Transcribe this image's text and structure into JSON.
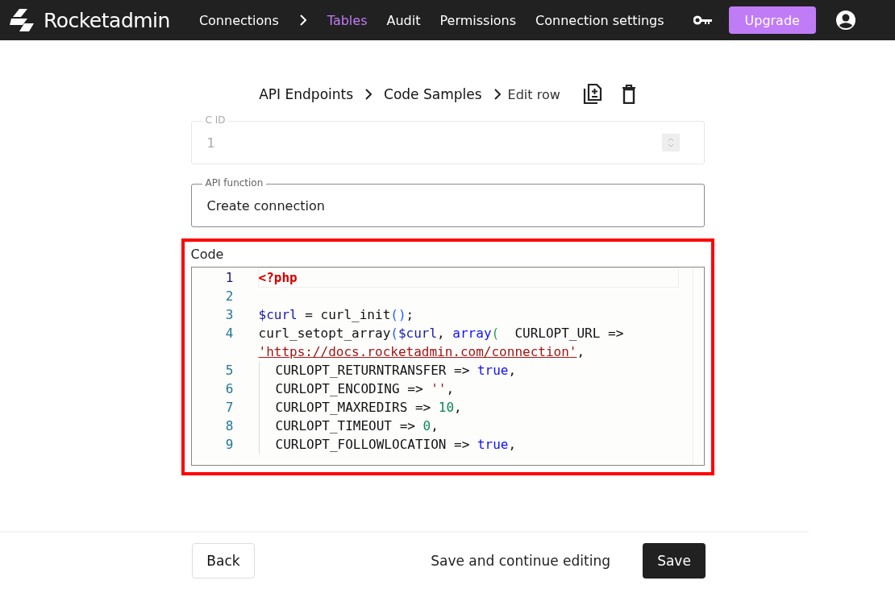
{
  "header": {
    "brand": "Rocketadmin",
    "nav": [
      {
        "label": "Connections",
        "selected": false
      },
      {
        "label": "Tables",
        "selected": true
      },
      {
        "label": "Audit",
        "selected": false
      },
      {
        "label": "Permissions",
        "selected": false
      },
      {
        "label": "Connection settings",
        "selected": false
      }
    ],
    "upgrade": "Upgrade"
  },
  "breadcrumbs": [
    "API Endpoints",
    "Code Samples"
  ],
  "page_title": "Edit row",
  "fields": [
    {
      "label": "C ID",
      "value": "1",
      "disabled": true,
      "kind": "number"
    },
    {
      "label": "API function",
      "value": "Create connection",
      "disabled": false,
      "kind": "text"
    }
  ],
  "code_field": {
    "label": "Code",
    "highlighted": true,
    "lines": [
      {
        "number": "1",
        "active": true,
        "indented": false,
        "tokens": [
          {
            "text": "<?php",
            "kind": "tag"
          }
        ]
      },
      {
        "number": "2",
        "active": false,
        "indented": false
      },
      {
        "number": "3",
        "active": false,
        "indented": false,
        "tokens": [
          {
            "text": "$curl",
            "kind": "var"
          },
          {
            "text": " = curl_init",
            "kind": "plain"
          },
          {
            "text": "()",
            "kind": "bracket"
          },
          {
            "text": ";",
            "kind": "plain"
          }
        ]
      },
      {
        "number": "4",
        "active": false,
        "indented": false,
        "tokens": [
          {
            "text": "curl_setopt_array",
            "kind": "plain"
          },
          {
            "text": "(",
            "kind": "bracket"
          },
          {
            "text": "$curl",
            "kind": "var"
          },
          {
            "text": ", ",
            "kind": "plain"
          },
          {
            "text": "array",
            "kind": "keyword"
          },
          {
            "text": "(",
            "kind": "bracket2"
          },
          {
            "text": "  CURLOPT_URL => ",
            "kind": "plain"
          },
          {
            "text": "'https://docs.rocketadmin.com/connection'",
            "kind": "string"
          },
          {
            "text": ",",
            "kind": "plain"
          }
        ]
      },
      {
        "number": "5",
        "active": false,
        "indented": true,
        "tokens": [
          {
            "text": "CURLOPT_RETURNTRANSFER => ",
            "kind": "plain"
          },
          {
            "text": "true",
            "kind": "keyword"
          },
          {
            "text": ",",
            "kind": "plain"
          }
        ]
      },
      {
        "number": "6",
        "active": false,
        "indented": true,
        "tokens": [
          {
            "text": "CURLOPT_ENCODING => ",
            "kind": "plain"
          },
          {
            "text": "''",
            "kind": "string"
          },
          {
            "text": ",",
            "kind": "plain"
          }
        ]
      },
      {
        "number": "7",
        "active": false,
        "indented": true,
        "tokens": [
          {
            "text": "CURLOPT_MAXREDIRS => ",
            "kind": "plain"
          },
          {
            "text": "10",
            "kind": "number"
          },
          {
            "text": ",",
            "kind": "plain"
          }
        ]
      },
      {
        "number": "8",
        "active": false,
        "indented": true,
        "tokens": [
          {
            "text": "CURLOPT_TIMEOUT => ",
            "kind": "plain"
          },
          {
            "text": "0",
            "kind": "number"
          },
          {
            "text": ",",
            "kind": "plain"
          }
        ]
      },
      {
        "number": "9",
        "active": false,
        "indented": true,
        "tokens": [
          {
            "text": "CURLOPT_FOLLOWLOCATION => ",
            "kind": "plain"
          },
          {
            "text": "true",
            "kind": "keyword"
          },
          {
            "text": ",",
            "kind": "plain"
          }
        ]
      }
    ]
  },
  "footer": {
    "back": "Back",
    "save_continue": "Save and continue editing",
    "save": "Save"
  }
}
